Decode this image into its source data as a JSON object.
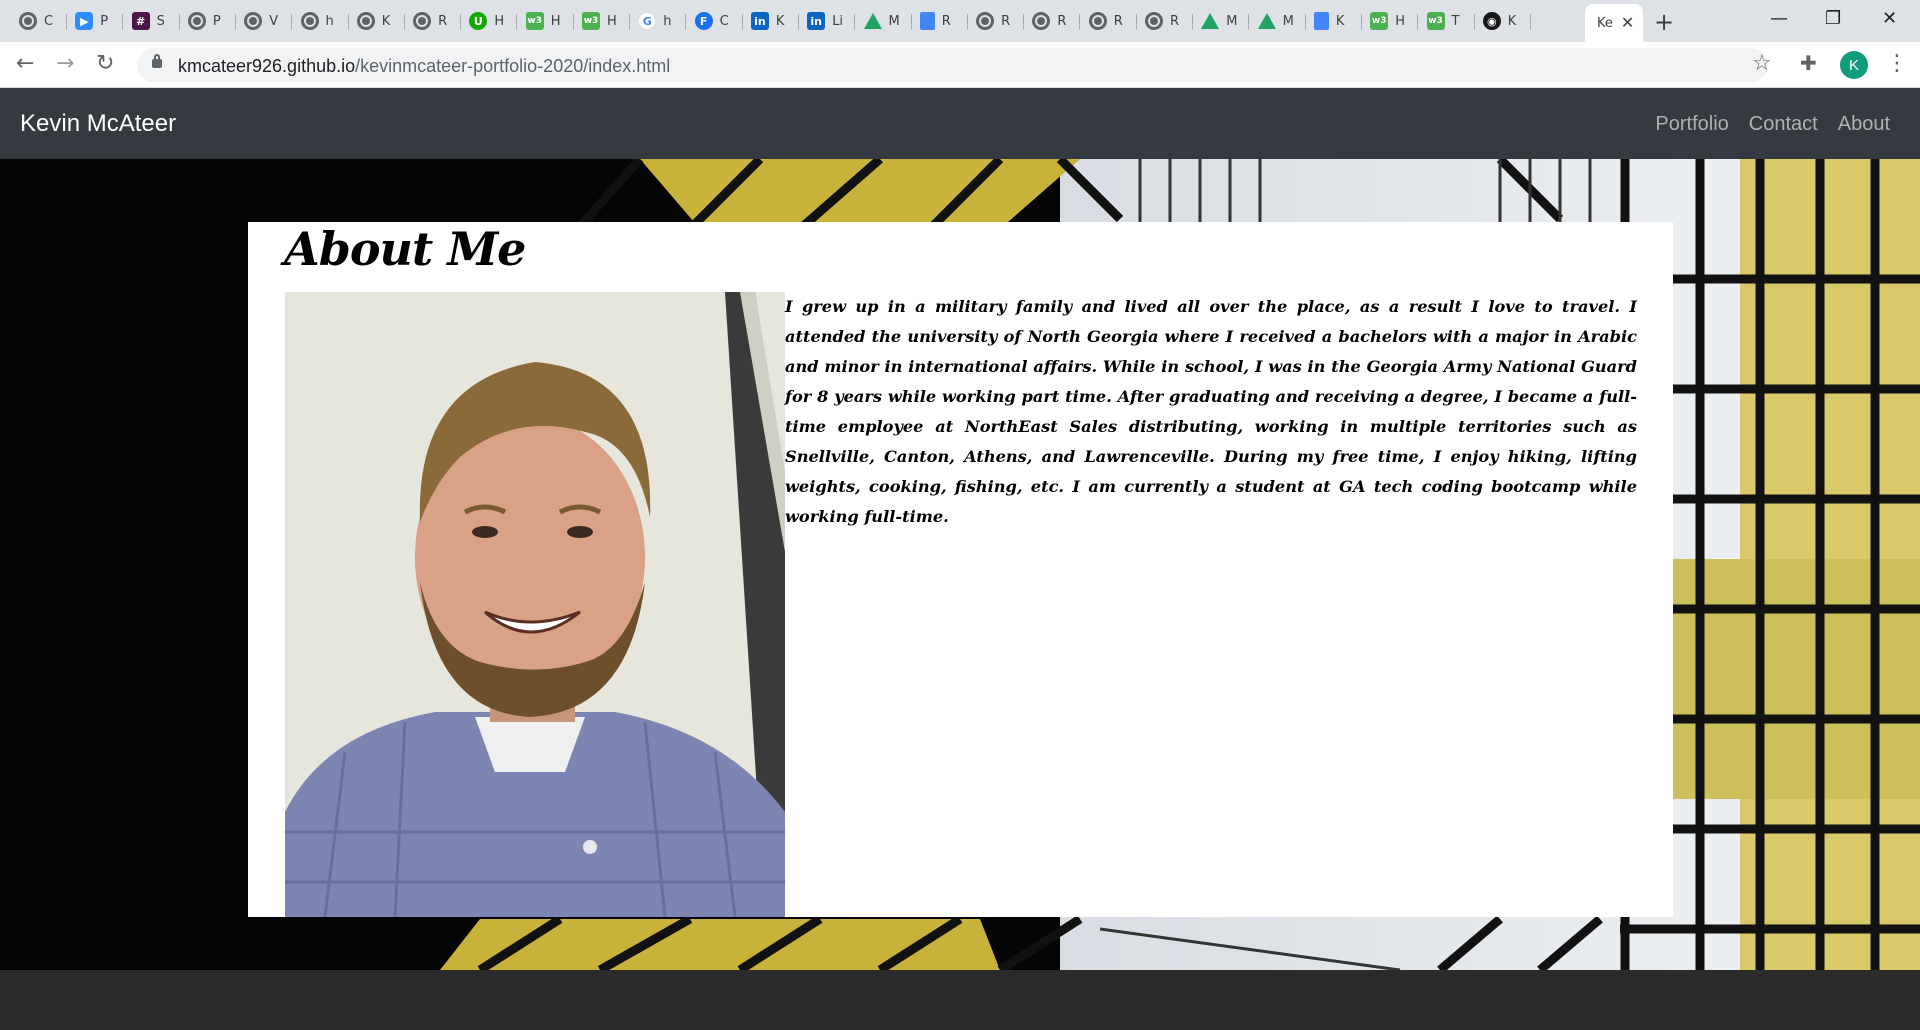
{
  "browser": {
    "tabs": [
      {
        "icon": "globe-icon",
        "letter": "C"
      },
      {
        "icon": "zoom-icon",
        "letter": "P"
      },
      {
        "icon": "slack-icon",
        "letter": "S"
      },
      {
        "icon": "globe-icon",
        "letter": "P"
      },
      {
        "icon": "globe-icon",
        "letter": "V"
      },
      {
        "icon": "globe-icon",
        "letter": "h"
      },
      {
        "icon": "globe-icon",
        "letter": "K"
      },
      {
        "icon": "globe-icon",
        "letter": "R"
      },
      {
        "icon": "upwork-icon",
        "letter": "H"
      },
      {
        "icon": "w3schools-icon",
        "letter": "H"
      },
      {
        "icon": "w3schools-icon",
        "letter": "H"
      },
      {
        "icon": "google-icon",
        "letter": "h"
      },
      {
        "icon": "f-icon",
        "letter": "C"
      },
      {
        "icon": "linkedin-icon",
        "letter": "K"
      },
      {
        "icon": "linkedin-icon",
        "letter": "Li"
      },
      {
        "icon": "drive-icon",
        "letter": "M"
      },
      {
        "icon": "docs-icon",
        "letter": "R"
      },
      {
        "icon": "globe-icon",
        "letter": "R"
      },
      {
        "icon": "globe-icon",
        "letter": "R"
      },
      {
        "icon": "globe-icon",
        "letter": "R"
      },
      {
        "icon": "globe-icon",
        "letter": "R"
      },
      {
        "icon": "drive-icon",
        "letter": "M"
      },
      {
        "icon": "drive-icon",
        "letter": "M"
      },
      {
        "icon": "docs-icon",
        "letter": "K"
      },
      {
        "icon": "w3schools-icon",
        "letter": "H"
      },
      {
        "icon": "w3schools-icon",
        "letter": "T"
      },
      {
        "icon": "github-icon",
        "letter": "K"
      }
    ],
    "active_tab": {
      "letter": "Ke"
    },
    "url_host": "kmcateer926.github.io",
    "url_path": "/kevinmcateer-portfolio-2020/index.html",
    "profile_initial": "K"
  },
  "nav": {
    "brand": "Kevin McAteer",
    "links": [
      "Portfolio",
      "Contact",
      "About"
    ]
  },
  "about": {
    "heading": "About Me",
    "bio": "I grew up in a military family and lived all over the place, as a result I love to travel. I attended the university of North Georgia where I received a bachelors with a major in Arabic and minor in international affairs. While in school, I was in the Georgia Army National Guard for 8 years while working part time. After graduating and receiving a degree, I became a full-time employee at NorthEast Sales distributing, working in multiple territories such as Snellville, Canton, Athens, and Lawrenceville. During my free time, I enjoy hiking, lifting weights, cooking, fishing, etc. I am currently a student at GA tech coding bootcamp while working full-time."
  },
  "colors": {
    "navbar": "#343a40",
    "tabstrip": "#dee1e6",
    "profile": "#0f9d7a"
  }
}
